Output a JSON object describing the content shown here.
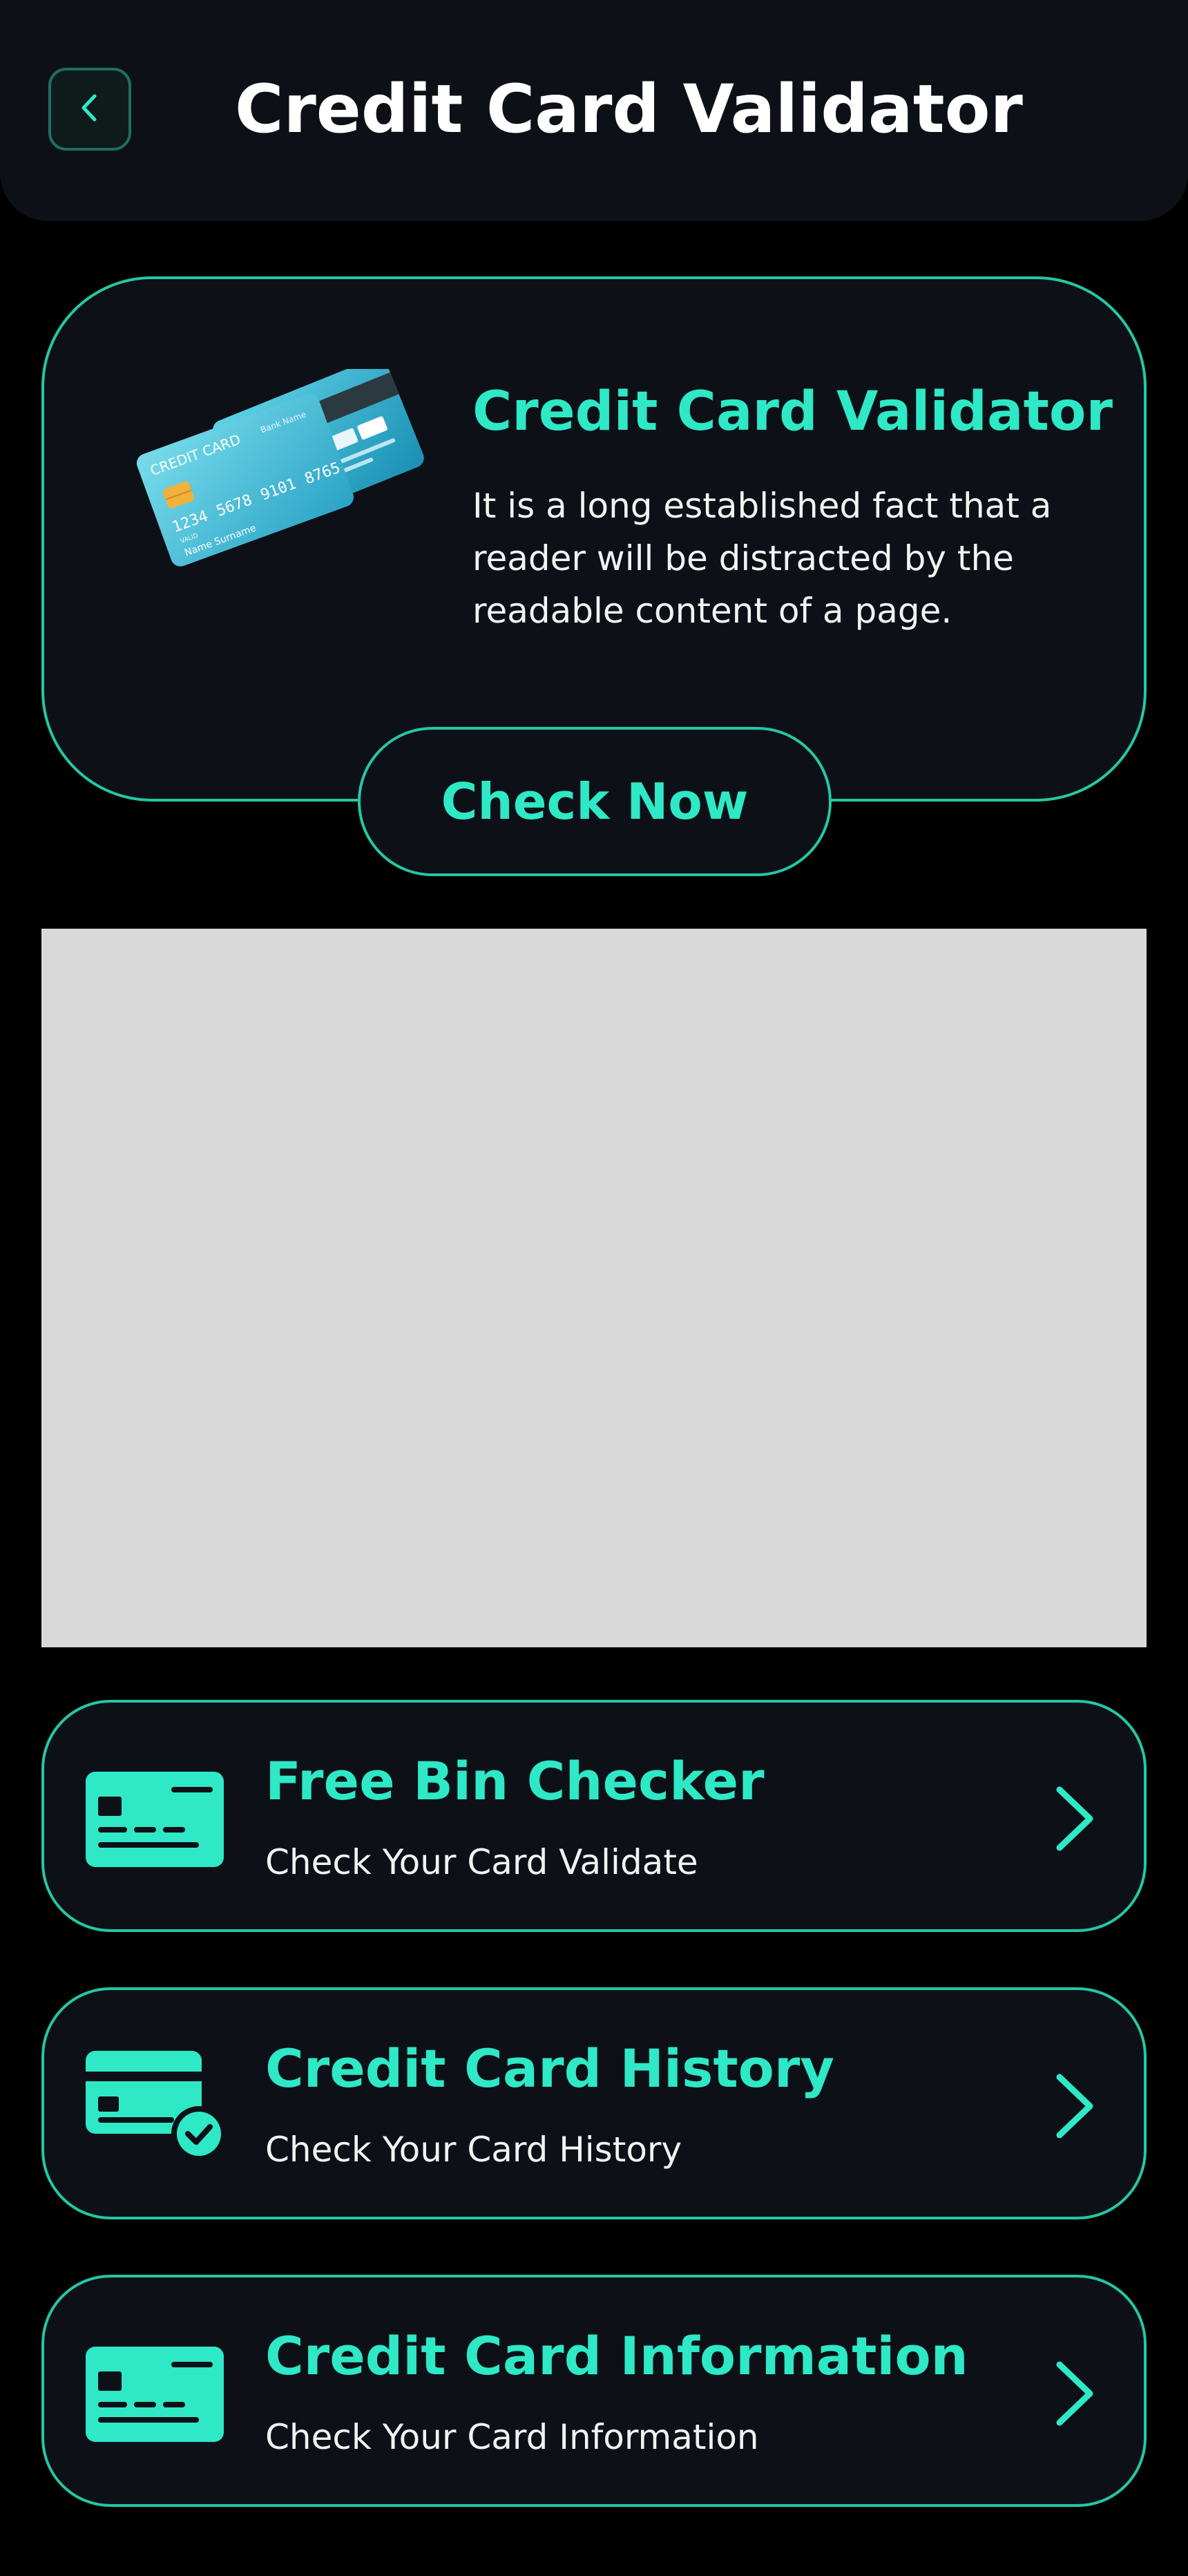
{
  "header": {
    "title": "Credit Card Validator",
    "back_icon": "chevron-left-icon"
  },
  "hero": {
    "title": "Credit Card Validator",
    "description": "It is a long established fact that a reader will be distracted by the readable content of a page.",
    "button_label": "Check Now",
    "card_front": {
      "brand": "CREDIT CARD",
      "bank": "Bank Name",
      "number_groups": [
        "1234",
        "5678",
        "9101",
        "8765"
      ],
      "valid_label": "VALID",
      "holder": "Name Surname"
    }
  },
  "menu": [
    {
      "title": "Free Bin Checker",
      "subtitle": "Check Your Card Validate",
      "icon": "credit-card-icon"
    },
    {
      "title": "Credit Card History",
      "subtitle": "Check Your Card History",
      "icon": "credit-card-check-icon"
    },
    {
      "title": "Credit Card Information",
      "subtitle": "Check Your Card Information",
      "icon": "credit-card-icon"
    }
  ],
  "colors": {
    "background": "#000000",
    "surface": "#0d1117",
    "accent": "#2ee8c6",
    "border": "#25c7a4",
    "ad_placeholder": "#d9d9d9"
  }
}
